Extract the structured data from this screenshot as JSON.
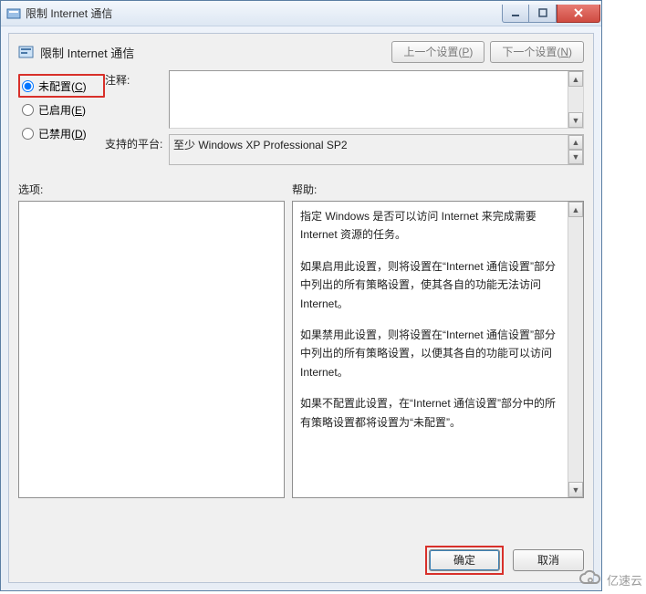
{
  "window": {
    "title": "限制 Internet 通信"
  },
  "header": {
    "title": "限制 Internet 通信",
    "prev_label": "上一个设置(P)",
    "next_label": "下一个设置(N)"
  },
  "radios": {
    "not_configured": "未配置(C)",
    "enabled": "已启用(E)",
    "disabled": "已禁用(D)",
    "selected": "not_configured"
  },
  "fields": {
    "comment_label": "注释:",
    "comment_value": "",
    "platform_label": "支持的平台:",
    "platform_value": "至少 Windows XP Professional SP2"
  },
  "section_labels": {
    "options": "选项:",
    "help": "帮助:"
  },
  "help": {
    "p1": "指定 Windows 是否可以访问 Internet 来完成需要 Internet 资源的任务。",
    "p2": "如果启用此设置，则将设置在“Internet 通信设置”部分中列出的所有策略设置，使其各自的功能无法访问 Internet。",
    "p3": "如果禁用此设置，则将设置在“Internet 通信设置”部分中列出的所有策略设置，以便其各自的功能可以访问 Internet。",
    "p4": "如果不配置此设置，在“Internet 通信设置”部分中的所有策略设置都将设置为“未配置”。"
  },
  "footer": {
    "ok": "确定",
    "cancel": "取消"
  },
  "watermark": "亿速云"
}
